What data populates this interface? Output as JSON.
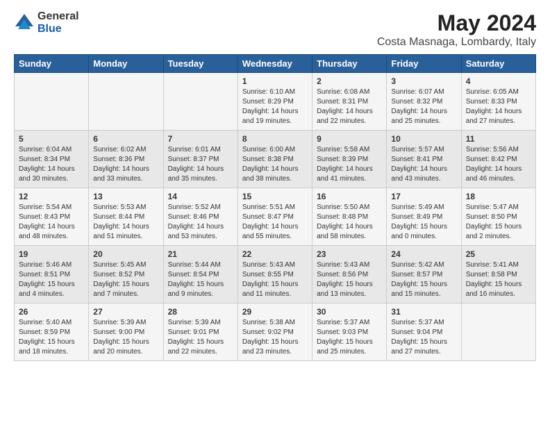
{
  "header": {
    "logo_general": "General",
    "logo_blue": "Blue",
    "title": "May 2024",
    "subtitle": "Costa Masnaga, Lombardy, Italy"
  },
  "days_of_week": [
    "Sunday",
    "Monday",
    "Tuesday",
    "Wednesday",
    "Thursday",
    "Friday",
    "Saturday"
  ],
  "weeks": [
    [
      {
        "num": "",
        "info": ""
      },
      {
        "num": "",
        "info": ""
      },
      {
        "num": "",
        "info": ""
      },
      {
        "num": "1",
        "info": "Sunrise: 6:10 AM\nSunset: 8:29 PM\nDaylight: 14 hours\nand 19 minutes."
      },
      {
        "num": "2",
        "info": "Sunrise: 6:08 AM\nSunset: 8:31 PM\nDaylight: 14 hours\nand 22 minutes."
      },
      {
        "num": "3",
        "info": "Sunrise: 6:07 AM\nSunset: 8:32 PM\nDaylight: 14 hours\nand 25 minutes."
      },
      {
        "num": "4",
        "info": "Sunrise: 6:05 AM\nSunset: 8:33 PM\nDaylight: 14 hours\nand 27 minutes."
      }
    ],
    [
      {
        "num": "5",
        "info": "Sunrise: 6:04 AM\nSunset: 8:34 PM\nDaylight: 14 hours\nand 30 minutes."
      },
      {
        "num": "6",
        "info": "Sunrise: 6:02 AM\nSunset: 8:36 PM\nDaylight: 14 hours\nand 33 minutes."
      },
      {
        "num": "7",
        "info": "Sunrise: 6:01 AM\nSunset: 8:37 PM\nDaylight: 14 hours\nand 35 minutes."
      },
      {
        "num": "8",
        "info": "Sunrise: 6:00 AM\nSunset: 8:38 PM\nDaylight: 14 hours\nand 38 minutes."
      },
      {
        "num": "9",
        "info": "Sunrise: 5:58 AM\nSunset: 8:39 PM\nDaylight: 14 hours\nand 41 minutes."
      },
      {
        "num": "10",
        "info": "Sunrise: 5:57 AM\nSunset: 8:41 PM\nDaylight: 14 hours\nand 43 minutes."
      },
      {
        "num": "11",
        "info": "Sunrise: 5:56 AM\nSunset: 8:42 PM\nDaylight: 14 hours\nand 46 minutes."
      }
    ],
    [
      {
        "num": "12",
        "info": "Sunrise: 5:54 AM\nSunset: 8:43 PM\nDaylight: 14 hours\nand 48 minutes."
      },
      {
        "num": "13",
        "info": "Sunrise: 5:53 AM\nSunset: 8:44 PM\nDaylight: 14 hours\nand 51 minutes."
      },
      {
        "num": "14",
        "info": "Sunrise: 5:52 AM\nSunset: 8:46 PM\nDaylight: 14 hours\nand 53 minutes."
      },
      {
        "num": "15",
        "info": "Sunrise: 5:51 AM\nSunset: 8:47 PM\nDaylight: 14 hours\nand 55 minutes."
      },
      {
        "num": "16",
        "info": "Sunrise: 5:50 AM\nSunset: 8:48 PM\nDaylight: 14 hours\nand 58 minutes."
      },
      {
        "num": "17",
        "info": "Sunrise: 5:49 AM\nSunset: 8:49 PM\nDaylight: 15 hours\nand 0 minutes."
      },
      {
        "num": "18",
        "info": "Sunrise: 5:47 AM\nSunset: 8:50 PM\nDaylight: 15 hours\nand 2 minutes."
      }
    ],
    [
      {
        "num": "19",
        "info": "Sunrise: 5:46 AM\nSunset: 8:51 PM\nDaylight: 15 hours\nand 4 minutes."
      },
      {
        "num": "20",
        "info": "Sunrise: 5:45 AM\nSunset: 8:52 PM\nDaylight: 15 hours\nand 7 minutes."
      },
      {
        "num": "21",
        "info": "Sunrise: 5:44 AM\nSunset: 8:54 PM\nDaylight: 15 hours\nand 9 minutes."
      },
      {
        "num": "22",
        "info": "Sunrise: 5:43 AM\nSunset: 8:55 PM\nDaylight: 15 hours\nand 11 minutes."
      },
      {
        "num": "23",
        "info": "Sunrise: 5:43 AM\nSunset: 8:56 PM\nDaylight: 15 hours\nand 13 minutes."
      },
      {
        "num": "24",
        "info": "Sunrise: 5:42 AM\nSunset: 8:57 PM\nDaylight: 15 hours\nand 15 minutes."
      },
      {
        "num": "25",
        "info": "Sunrise: 5:41 AM\nSunset: 8:58 PM\nDaylight: 15 hours\nand 16 minutes."
      }
    ],
    [
      {
        "num": "26",
        "info": "Sunrise: 5:40 AM\nSunset: 8:59 PM\nDaylight: 15 hours\nand 18 minutes."
      },
      {
        "num": "27",
        "info": "Sunrise: 5:39 AM\nSunset: 9:00 PM\nDaylight: 15 hours\nand 20 minutes."
      },
      {
        "num": "28",
        "info": "Sunrise: 5:39 AM\nSunset: 9:01 PM\nDaylight: 15 hours\nand 22 minutes."
      },
      {
        "num": "29",
        "info": "Sunrise: 5:38 AM\nSunset: 9:02 PM\nDaylight: 15 hours\nand 23 minutes."
      },
      {
        "num": "30",
        "info": "Sunrise: 5:37 AM\nSunset: 9:03 PM\nDaylight: 15 hours\nand 25 minutes."
      },
      {
        "num": "31",
        "info": "Sunrise: 5:37 AM\nSunset: 9:04 PM\nDaylight: 15 hours\nand 27 minutes."
      },
      {
        "num": "",
        "info": ""
      }
    ]
  ]
}
